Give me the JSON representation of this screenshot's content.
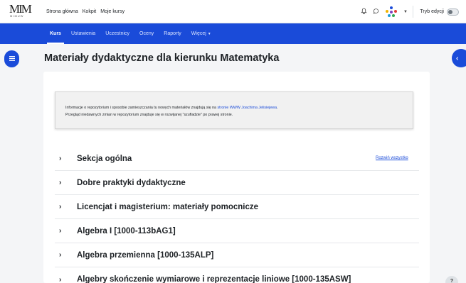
{
  "logo": {
    "mark": "MIM",
    "sub": "MIMUW"
  },
  "topnav": {
    "home": "Strona główna",
    "dashboard": "Kokpit",
    "courses": "Moje kursy"
  },
  "icons": {
    "notifications": "bell-icon",
    "messages": "chat-icon",
    "user_menu": "chevron-down-icon"
  },
  "edit_mode": {
    "label": "Tryb edycji",
    "enabled": false
  },
  "secnav": {
    "items": [
      {
        "label": "Kurs",
        "active": true
      },
      {
        "label": "Ustawienia"
      },
      {
        "label": "Uczestnicy"
      },
      {
        "label": "Oceny"
      },
      {
        "label": "Raporty"
      },
      {
        "label": "Więcej"
      }
    ]
  },
  "drawer_right_glyph": "‹",
  "page_title": "Materiały dydaktyczne dla kierunku Matematyka",
  "info": {
    "line1_prefix": "Informacje o repozytorium i sposobie zamieszczania tu nowych materiałów znajdują się na ",
    "line1_link": "stronie WWW Joachima Jelisiejewa",
    "line1_suffix": ".",
    "line2": "Przegląd niedawnych zmian w repozytorium znajduje się w rozwijanej \"szufladzie\" po prawej stronie."
  },
  "expand_all": "Rozwiń wszystko",
  "sections": [
    "Sekcja ogólna",
    "Dobre praktyki dydaktyczne",
    "Licencjat i magisterium: materiały pomocnicze",
    "Algebra I [1000-113bAG1]",
    "Algebra przemienna [1000-135ALP]",
    "Algebry skończenie wymiarowe i reprezentacje liniowe [1000-135ASW]"
  ],
  "help_label": "?",
  "colors": {
    "brand": "#1a4bd9",
    "text": "#1d2125",
    "background": "#f4f5f7"
  }
}
